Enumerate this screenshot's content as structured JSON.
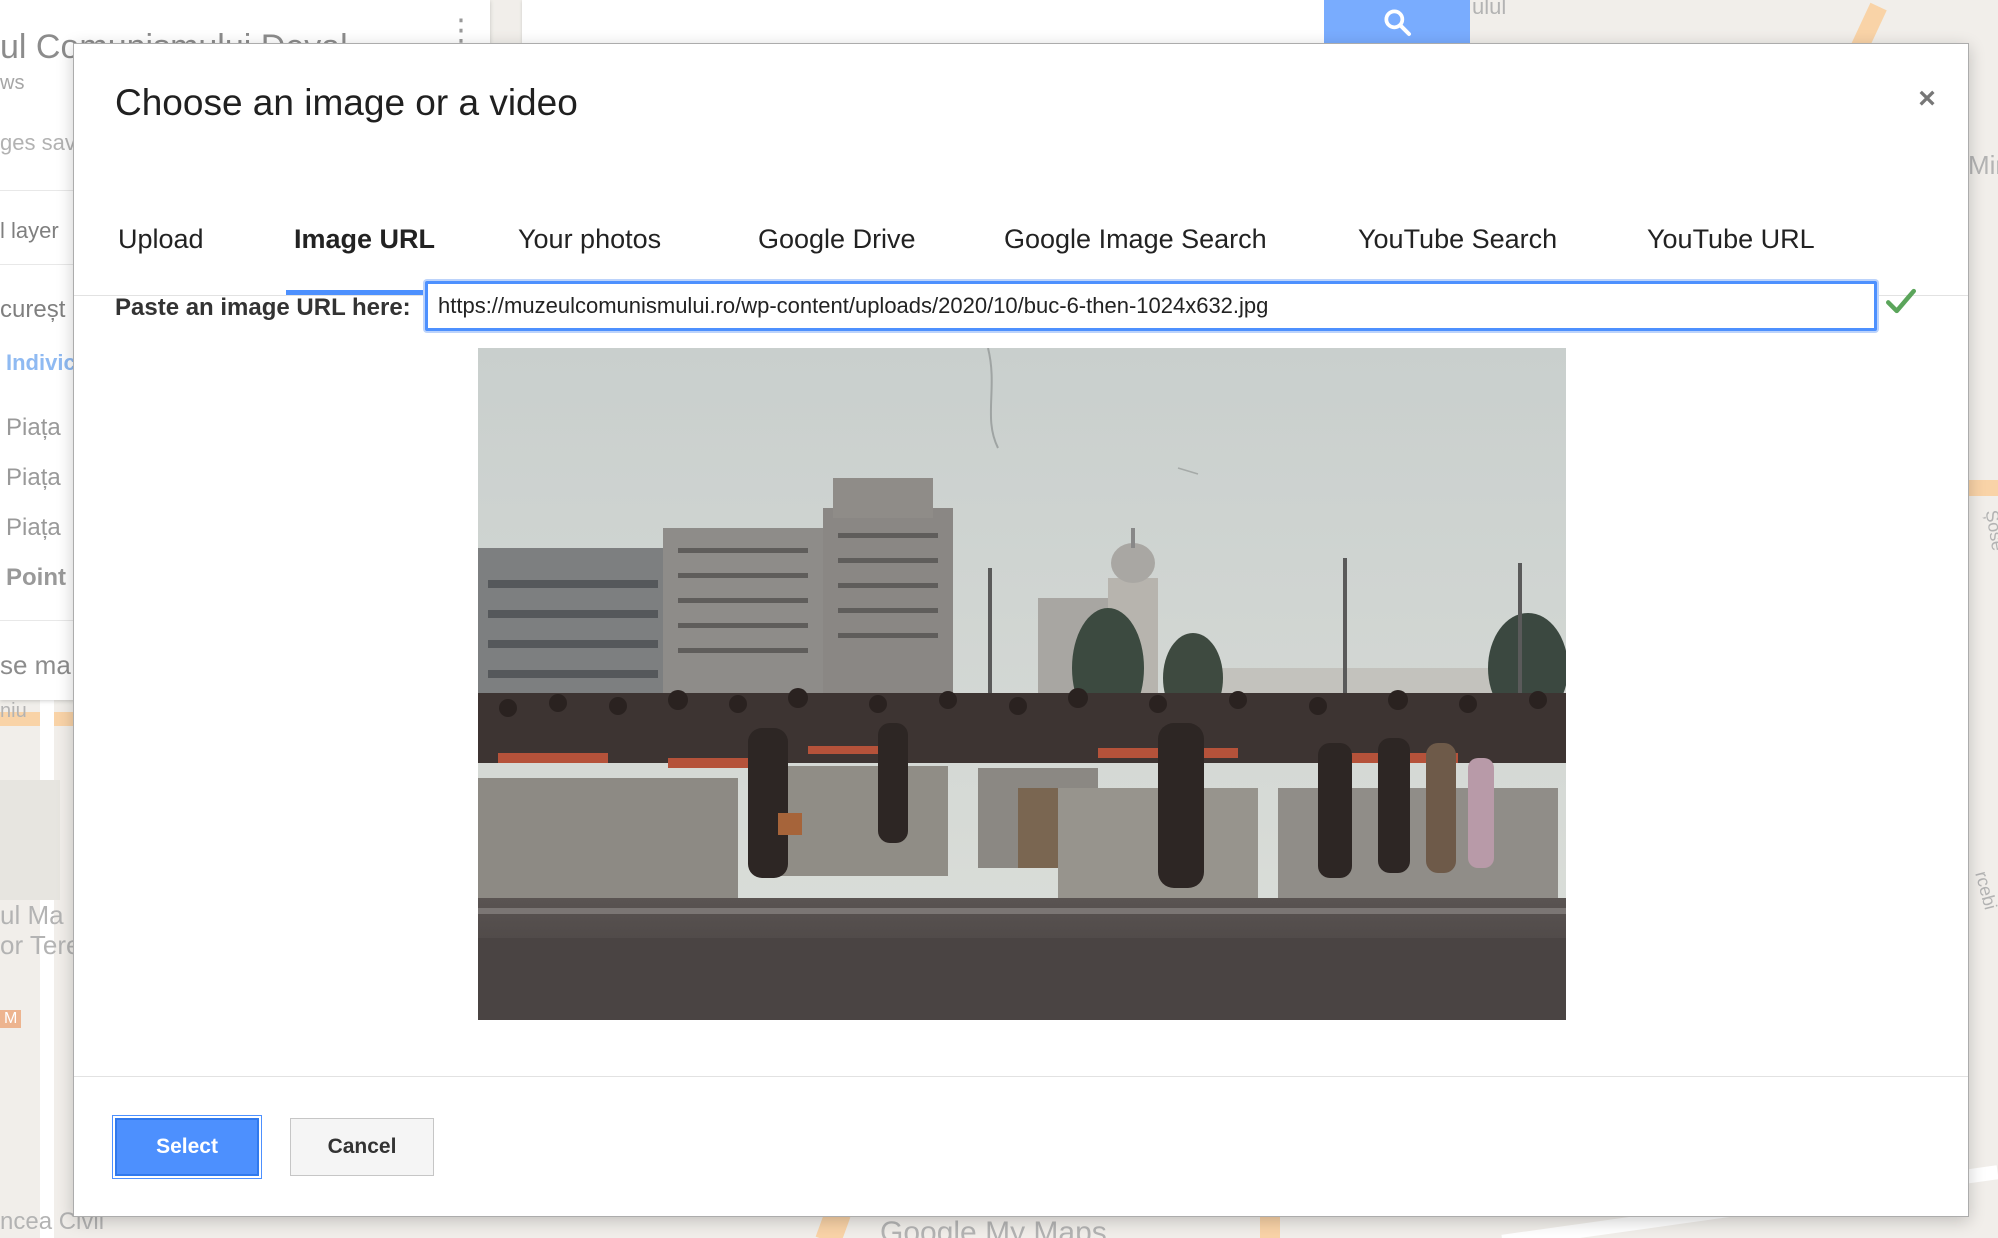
{
  "background_panel": {
    "title_fragment": "ul Comunismului Deval",
    "subtitle_fragment": "ws",
    "line3": "ges sav",
    "layer_label": "l layer",
    "city": "cureșt",
    "layer_style": "Indivic",
    "items": [
      "Piața",
      "Piața",
      "Piața",
      "Point"
    ],
    "base_map": "se ma"
  },
  "map": {
    "labels": [
      "ulul",
      "niu",
      "ul Ma",
      "or Tere",
      "M",
      "ncea Civil",
      "Șose",
      "Mircea",
      "rcebi",
      "Google My Maps"
    ]
  },
  "dialog": {
    "title": "Choose an image or a video",
    "close_symbol": "×",
    "tabs": [
      {
        "label": "Upload",
        "active": false
      },
      {
        "label": "Image URL",
        "active": true
      },
      {
        "label": "Your photos",
        "active": false
      },
      {
        "label": "Google Drive",
        "active": false
      },
      {
        "label": "Google Image Search",
        "active": false
      },
      {
        "label": "YouTube Search",
        "active": false
      },
      {
        "label": "YouTube URL",
        "active": false
      }
    ],
    "url_label": "Paste an image URL here:",
    "url_value": "https://muzeulcomunismului.ro/wp-content/uploads/2020/10/buc-6-then-1024x632.jpg",
    "buttons": {
      "select": "Select",
      "cancel": "Cancel"
    }
  },
  "colors": {
    "accent": "#4d90fe",
    "check": "#5ba55b"
  },
  "icons": {
    "search": "search-icon",
    "close": "close-icon",
    "valid": "checkmark-icon",
    "menu": "kebab-menu-icon"
  }
}
